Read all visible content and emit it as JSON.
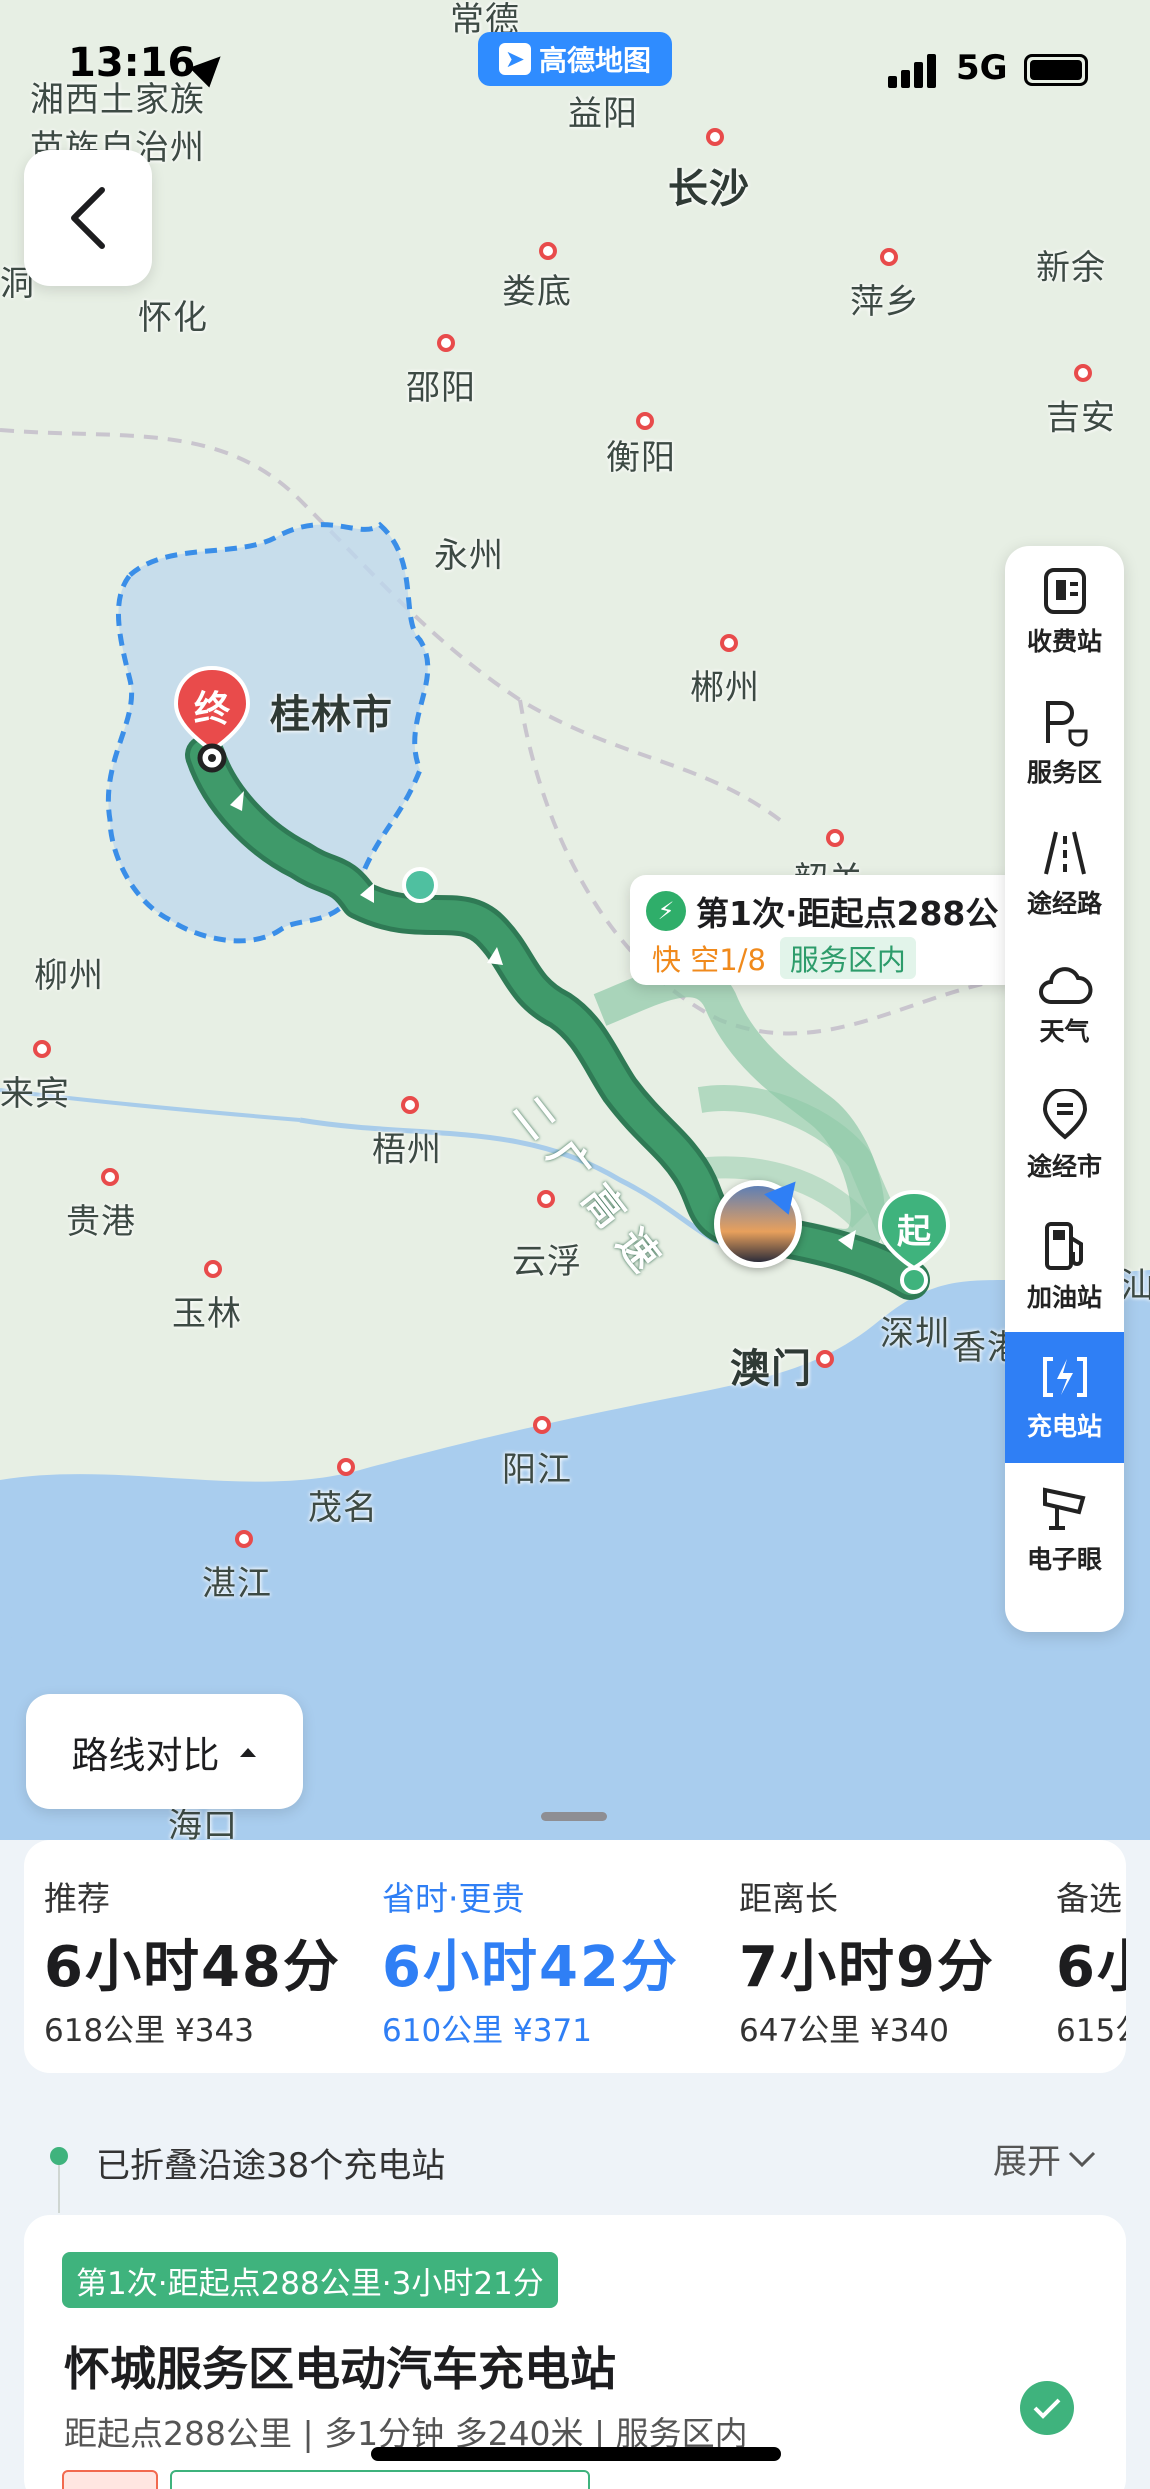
{
  "status_bar": {
    "time": "13:16",
    "network": "5G",
    "app_badge": "高德地图"
  },
  "map": {
    "cities": [
      {
        "name": "常德",
        "big": false
      },
      {
        "name": "湘西土家族",
        "big": false
      },
      {
        "name": "苗族自治州",
        "big": false
      },
      {
        "name": "益阳",
        "big": false
      },
      {
        "name": "长沙",
        "big": true
      },
      {
        "name": "怀化",
        "big": false
      },
      {
        "name": "娄底",
        "big": false
      },
      {
        "name": "萍乡",
        "big": false
      },
      {
        "name": "新余",
        "big": false
      },
      {
        "name": "邵阳",
        "big": false
      },
      {
        "name": "衡阳",
        "big": false
      },
      {
        "name": "吉安",
        "big": false
      },
      {
        "name": "永州",
        "big": false
      },
      {
        "name": "郴州",
        "big": false
      },
      {
        "name": "桂林市",
        "big": true
      },
      {
        "name": "韶关",
        "big": false
      },
      {
        "name": "柳州",
        "big": false
      },
      {
        "name": "来宾",
        "big": false
      },
      {
        "name": "梧州",
        "big": false
      },
      {
        "name": "贵港",
        "big": false
      },
      {
        "name": "云浮",
        "big": false
      },
      {
        "name": "玉林",
        "big": false
      },
      {
        "name": "澳门",
        "big": true
      },
      {
        "name": "深圳",
        "big": false
      },
      {
        "name": "香港",
        "big": false
      },
      {
        "name": "茂名",
        "big": false
      },
      {
        "name": "阳江",
        "big": false
      },
      {
        "name": "湛江",
        "big": false
      },
      {
        "name": "海口",
        "big": false
      },
      {
        "name": "汕",
        "big": false
      },
      {
        "name": "洞",
        "big": false
      }
    ],
    "road_label": "二广高速",
    "start_marker": "起",
    "end_marker": "终"
  },
  "callout": {
    "title": "第1次·距起点288公",
    "fast": "快 空1/8",
    "location": "服务区内"
  },
  "toolbar": [
    {
      "label": "收费站",
      "icon": "toll-station-icon",
      "active": false
    },
    {
      "label": "服务区",
      "icon": "service-area-icon",
      "active": false
    },
    {
      "label": "途经路",
      "icon": "route-road-icon",
      "active": false
    },
    {
      "label": "天气",
      "icon": "weather-icon",
      "active": false
    },
    {
      "label": "途经市",
      "icon": "city-icon",
      "active": false
    },
    {
      "label": "加油站",
      "icon": "gas-station-icon",
      "active": false
    },
    {
      "label": "充电站",
      "icon": "charging-station-icon",
      "active": true
    },
    {
      "label": "电子眼",
      "icon": "camera-icon",
      "active": false
    }
  ],
  "compare_button": "路线对比",
  "routes": [
    {
      "tag": "推荐",
      "duration": "6小时48分",
      "meta": "618公里 ¥343",
      "selected": false
    },
    {
      "tag": "省时·更贵",
      "duration": "6小时42分",
      "meta": "610公里 ¥371",
      "selected": true
    },
    {
      "tag": "距离长",
      "duration": "7小时9分",
      "meta": "647公里 ¥340",
      "selected": false
    },
    {
      "tag": "备选",
      "duration": "6小",
      "meta": "615公",
      "selected": false
    }
  ],
  "folded": {
    "text": "已折叠沿途38个充电站",
    "expand": "展开"
  },
  "station_card": {
    "badge": "第1次·距起点288公里·3小时21分",
    "name": "怀城服务区电动汽车充电站",
    "meta": "距起点288公里 | 多1分钟 多240米 | 服务区内"
  },
  "colors": {
    "accent": "#2f7ff5",
    "route_green": "#2f7a55",
    "region_blue": "#bcd7ee"
  }
}
